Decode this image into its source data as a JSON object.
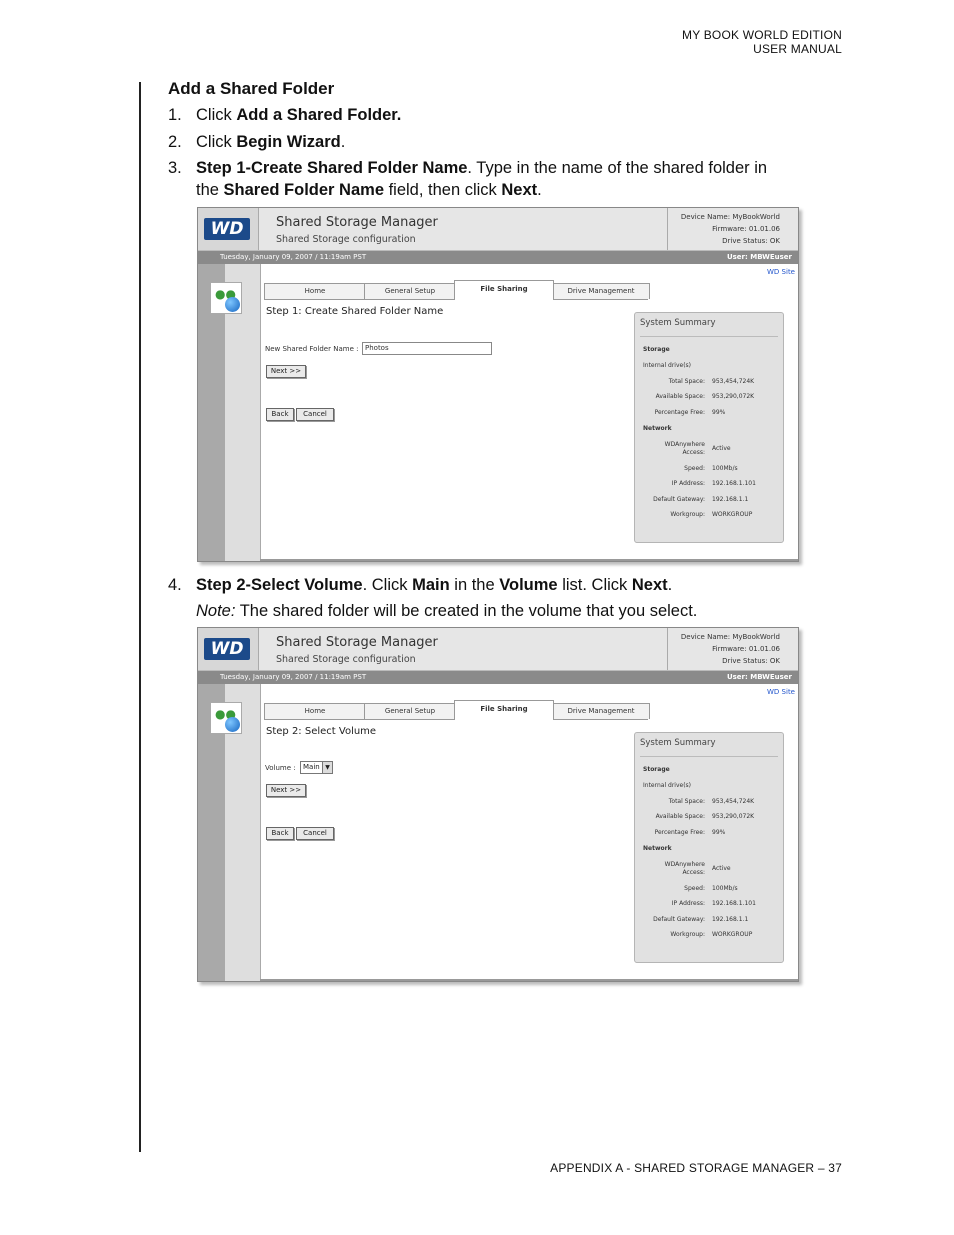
{
  "header": {
    "line1": "MY BOOK WORLD EDITION",
    "line2": "USER MANUAL"
  },
  "footer": "APPENDIX A - SHARED STORAGE MANAGER – 37",
  "section_title": "Add a Shared Folder",
  "steps": {
    "s1": {
      "num": "1.",
      "pre": "Click ",
      "bold": "Add a Shared Folder."
    },
    "s2": {
      "num": "2.",
      "pre": "Click ",
      "bold": "Begin Wizard",
      "post": "."
    },
    "s3": {
      "num": "3.",
      "b1": "Step 1-Create Shared Folder Name",
      "t1": ". Type in the name of the shared folder in",
      "t2": "the ",
      "b2": "Shared Folder Name",
      "t3": " field, then click ",
      "b3": "Next",
      "t4": "."
    },
    "s4": {
      "num": "4.",
      "b1": "Step 2-Select Volume",
      "t1": ". Click ",
      "b2": "Main",
      "t2": " in the ",
      "b3": "Volume",
      "t3": " list. Click ",
      "b4": "Next",
      "t4": "."
    },
    "note": {
      "label": "Note:",
      "text": " The shared folder will be created in the volume that you select."
    }
  },
  "ui": {
    "logo": "WD",
    "app_title": "Shared Storage Manager",
    "app_subtitle": "Shared Storage configuration",
    "device_name": "Device Name: MyBookWorld",
    "firmware": "Firmware: 01.01.06",
    "drive_status": "Drive Status: OK",
    "date": "Tuesday, January 09, 2007 / 11:19am PST",
    "user": "User: MBWEuser",
    "wd_site": "WD Site",
    "tabs": [
      "Home",
      "General Setup",
      "File Sharing",
      "Drive Management"
    ],
    "next_btn": "Next >>",
    "back_btn": "Back",
    "cancel_btn": "Cancel",
    "summary": {
      "title": "System Summary",
      "storage": "Storage",
      "internal": "Internal drive(s)",
      "total_space_k": "Total Space:",
      "total_space_v": "953,454,724K",
      "avail_k": "Available Space:",
      "avail_v": "953,290,072K",
      "pct_k": "Percentage Free:",
      "pct_v": "99%",
      "network": "Network",
      "wda_k1": "WDAnywhere",
      "wda_k2": "Access:",
      "wda_v": "Active",
      "speed_k": "Speed:",
      "speed_v": "100Mb/s",
      "ip_k": "IP Address:",
      "ip_v": "192.168.1.101",
      "gw_k": "Default Gateway:",
      "gw_v": "192.168.1.1",
      "wg_k": "Workgroup:",
      "wg_v": "WORKGROUP"
    }
  },
  "screen1": {
    "step_title": "Step 1: Create Shared Folder Name",
    "field_label": "New Shared Folder Name :",
    "field_value": "Photos"
  },
  "screen2": {
    "step_title": "Step 2: Select Volume",
    "field_label": "Volume :",
    "select_value": "Main"
  }
}
